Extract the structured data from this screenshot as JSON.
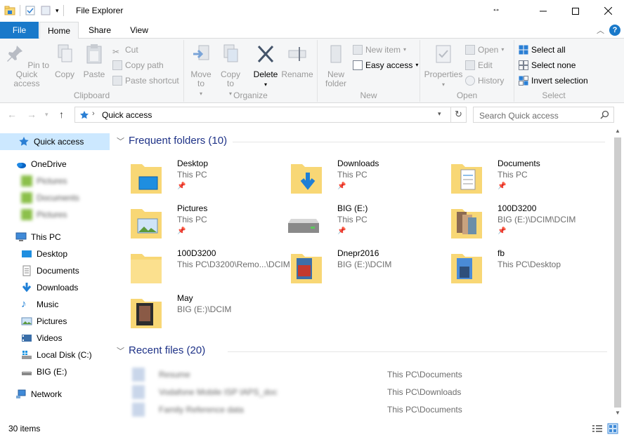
{
  "window": {
    "title": "File Explorer"
  },
  "tabs": {
    "file": "File",
    "home": "Home",
    "share": "Share",
    "view": "View"
  },
  "ribbon": {
    "clipboard": {
      "label": "Clipboard",
      "pin": "Pin to Quick access",
      "copy": "Copy",
      "paste": "Paste",
      "cut": "Cut",
      "copy_path": "Copy path",
      "paste_shortcut": "Paste shortcut"
    },
    "organize": {
      "label": "Organize",
      "move_to": "Move to",
      "copy_to": "Copy to",
      "delete": "Delete",
      "rename": "Rename"
    },
    "new": {
      "label": "New",
      "new_folder": "New folder",
      "new_item": "New item",
      "easy_access": "Easy access"
    },
    "open": {
      "label": "Open",
      "properties": "Properties",
      "open": "Open",
      "edit": "Edit",
      "history": "History"
    },
    "select": {
      "label": "Select",
      "select_all": "Select all",
      "select_none": "Select none",
      "invert": "Invert selection"
    }
  },
  "address": {
    "location": "Quick access",
    "search_placeholder": "Search Quick access"
  },
  "nav": {
    "quick_access": "Quick access",
    "onedrive": "OneDrive",
    "onedrive_items": [
      "Pictures",
      "Documents",
      "Pictures"
    ],
    "this_pc": "This PC",
    "pc_items": [
      "Desktop",
      "Documents",
      "Downloads",
      "Music",
      "Pictures",
      "Videos",
      "Local Disk (C:)",
      "BIG (E:)"
    ],
    "network": "Network"
  },
  "frequent": {
    "heading": "Frequent folders (10)",
    "items": [
      {
        "name": "Desktop",
        "path": "This PC",
        "icon": "desktop-folder-icon"
      },
      {
        "name": "Downloads",
        "path": "This PC",
        "icon": "downloads-folder-icon"
      },
      {
        "name": "Documents",
        "path": "This PC",
        "icon": "documents-folder-icon"
      },
      {
        "name": "Pictures",
        "path": "This PC",
        "icon": "pictures-folder-icon"
      },
      {
        "name": "BIG (E:)",
        "path": "This PC",
        "icon": "drive-icon"
      },
      {
        "name": "100D3200",
        "path": "BIG (E:)\\DCIM\\DCIM",
        "icon": "photo-folder-icon"
      },
      {
        "name": "100D3200",
        "path": "This PC\\D3200\\Remo...\\DCIM",
        "icon": "folder-icon"
      },
      {
        "name": "Dnepr2016",
        "path": "BIG (E:)\\DCIM",
        "icon": "photo-folder-icon"
      },
      {
        "name": "fb",
        "path": "This PC\\Desktop",
        "icon": "photo-folder-icon"
      },
      {
        "name": "May",
        "path": "BIG (E:)\\DCIM",
        "icon": "photo-folder-icon"
      }
    ]
  },
  "recent": {
    "heading": "Recent files (20)",
    "items": [
      {
        "name": "Resume",
        "location": "This PC\\Documents"
      },
      {
        "name": "Vodafone Mobile ISP IAPS_doc",
        "location": "This PC\\Downloads"
      },
      {
        "name": "Family Reference data",
        "location": "This PC\\Documents"
      }
    ]
  },
  "status": {
    "count": "30 items"
  },
  "colors": {
    "accent": "#1979ca",
    "folder": "#f8d775",
    "heading": "#1e3287"
  }
}
